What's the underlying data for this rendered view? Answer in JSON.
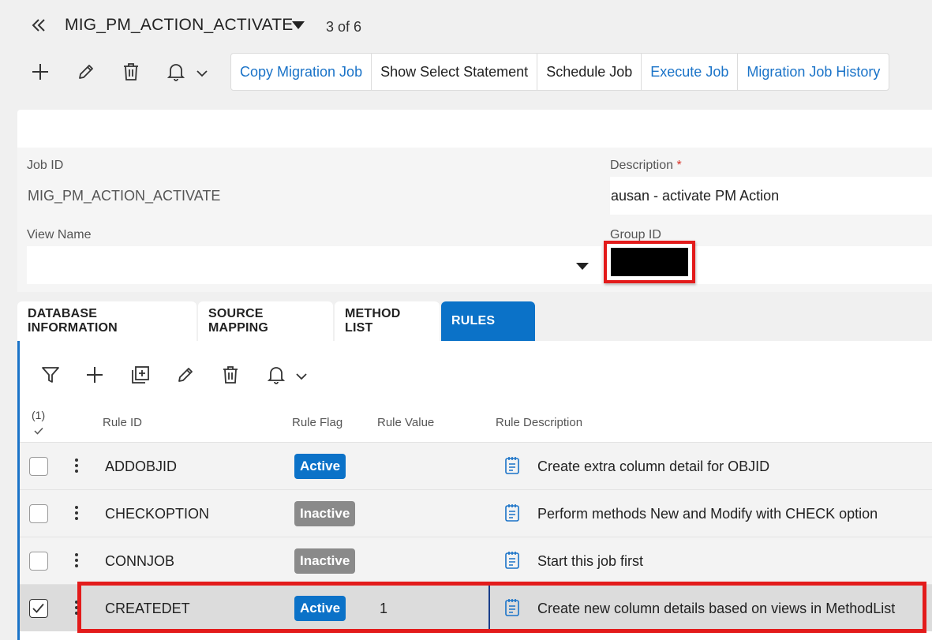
{
  "header": {
    "title": "MIG_PM_ACTION_ACTIVATE",
    "counter": "3 of 6"
  },
  "toolbar": {
    "buttons": [
      {
        "label": "Copy Migration Job",
        "style": "link"
      },
      {
        "label": "Show Select Statement",
        "style": "normal"
      },
      {
        "label": "Schedule Job",
        "style": "normal"
      },
      {
        "label": "Execute Job",
        "style": "link"
      },
      {
        "label": "Migration Job History",
        "style": "link"
      }
    ]
  },
  "form": {
    "job_id_label": "Job ID",
    "job_id_value": "MIG_PM_ACTION_ACTIVATE",
    "description_label": "Description",
    "description_required": "*",
    "description_value": "ausan - activate PM Action",
    "view_name_label": "View Name",
    "view_name_value": "",
    "group_id_label": "Group ID"
  },
  "tabs": [
    {
      "label": "DATABASE INFORMATION",
      "active": false
    },
    {
      "label": "SOURCE MAPPING",
      "active": false
    },
    {
      "label": "METHOD LIST",
      "active": false
    },
    {
      "label": "RULES",
      "active": true
    }
  ],
  "rules": {
    "selected_count": "(1)",
    "columns": {
      "rule_id": "Rule ID",
      "rule_flag": "Rule Flag",
      "rule_value": "Rule Value",
      "rule_description": "Rule Description"
    },
    "rows": [
      {
        "rule_id": "ADDOBJID",
        "flag": "Active",
        "value": "",
        "description": "Create extra column detail for OBJID",
        "selected": false
      },
      {
        "rule_id": "CHECKOPTION",
        "flag": "Inactive",
        "value": "",
        "description": "Perform methods New and Modify with CHECK option",
        "selected": false
      },
      {
        "rule_id": "CONNJOB",
        "flag": "Inactive",
        "value": "",
        "description": "Start this job first",
        "selected": false
      },
      {
        "rule_id": "CREATEDET",
        "flag": "Active",
        "value": "1",
        "description": "Create new column details based on views in MethodList",
        "selected": true
      }
    ]
  },
  "colors": {
    "accent": "#0b72c8",
    "link": "#1a73c8",
    "inactive_badge": "#8a8a8a",
    "highlight": "#e31b1b"
  }
}
